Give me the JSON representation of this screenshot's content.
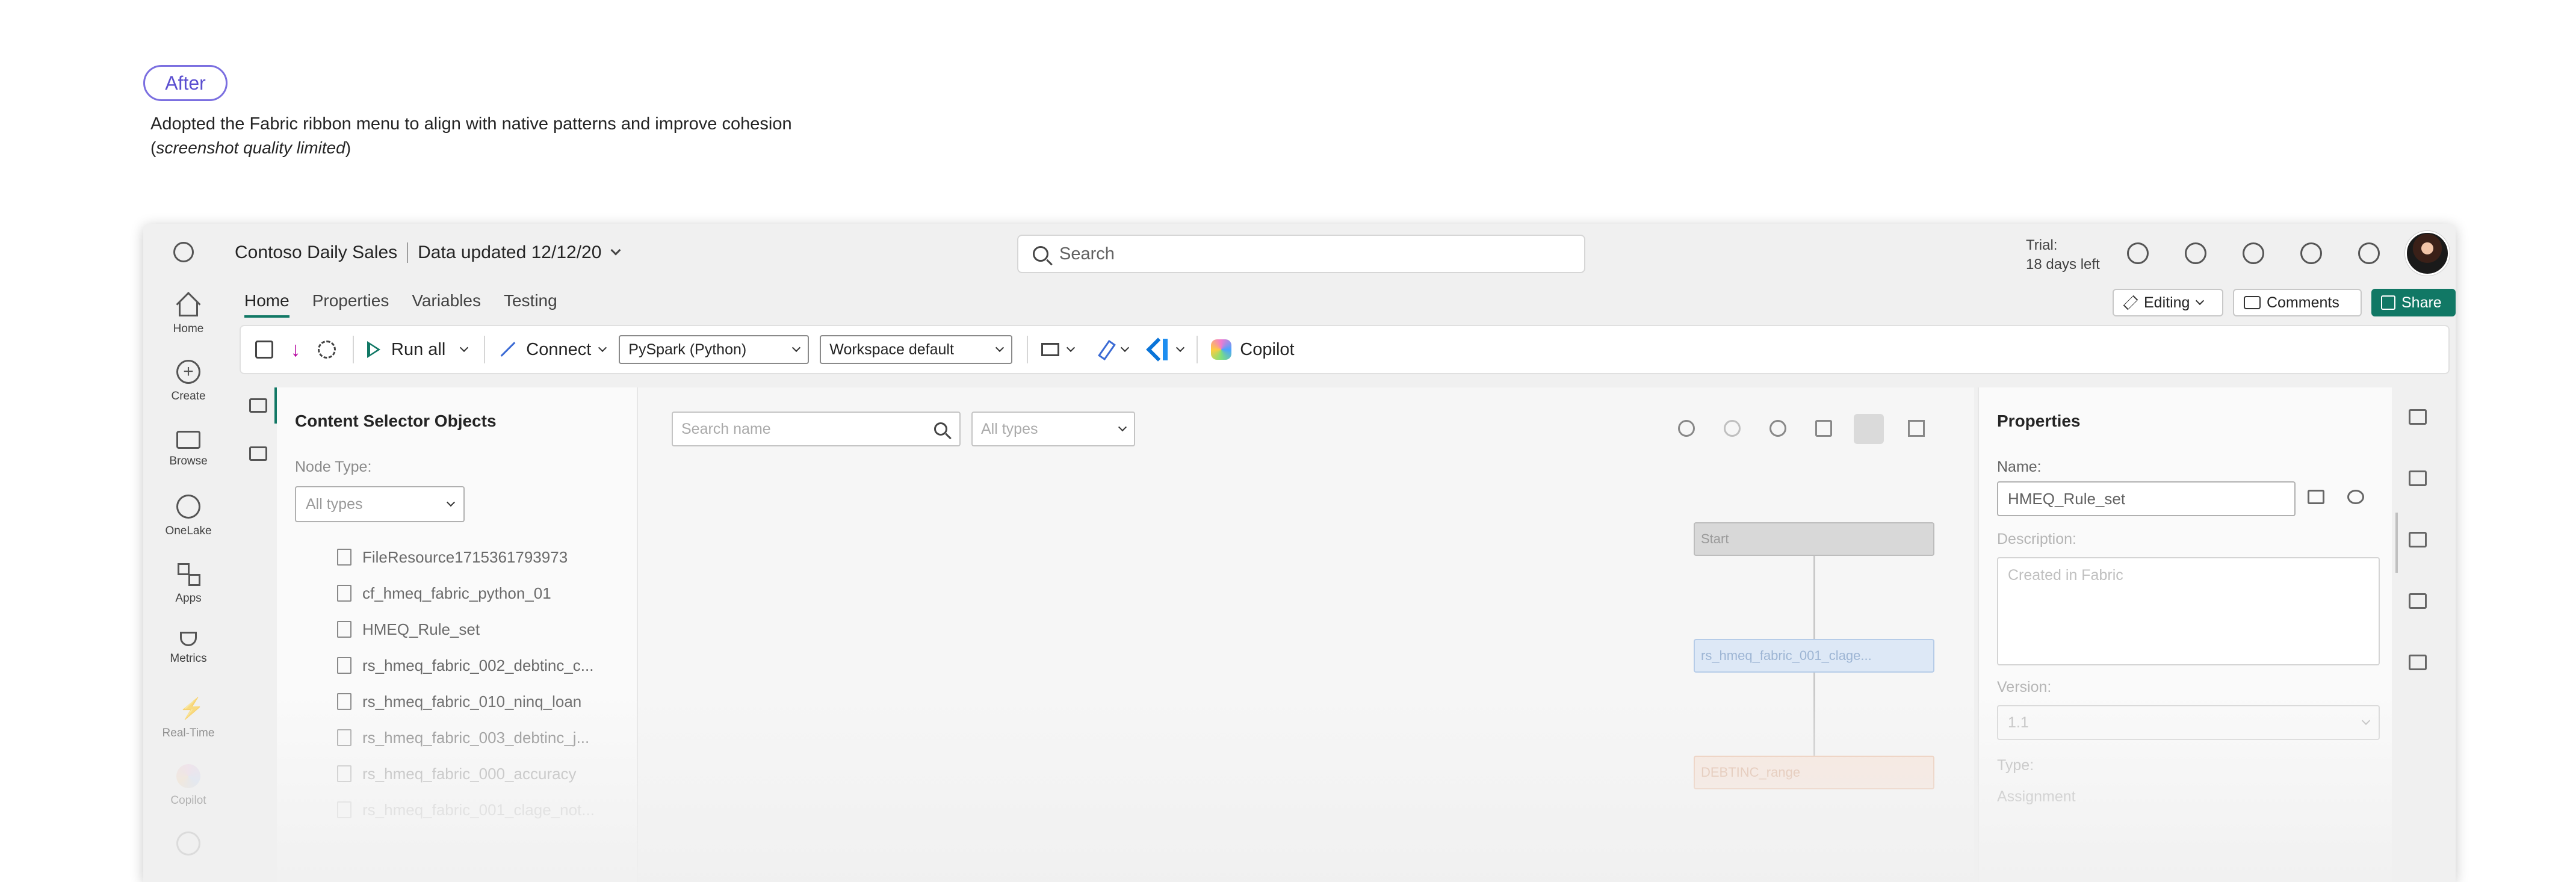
{
  "annotation": {
    "badge": "After",
    "caption": "Adopted the Fabric ribbon menu to align with native patterns and improve cohesion",
    "note_open": "(",
    "note_italic": "screenshot quality limited",
    "note_close": ")"
  },
  "header": {
    "item_name": "Contoso Daily Sales",
    "data_updated": "Data updated 12/12/20",
    "search_placeholder": "Search",
    "trial_line1": "Trial:",
    "trial_line2": "18 days left"
  },
  "left_nav": [
    {
      "label": "Home",
      "icon": "home-icon"
    },
    {
      "label": "Create",
      "icon": "create-icon"
    },
    {
      "label": "Browse",
      "icon": "browse-icon"
    },
    {
      "label": "OneLake",
      "icon": "onelake-icon"
    },
    {
      "label": "Apps",
      "icon": "apps-icon"
    },
    {
      "label": "Metrics",
      "icon": "metrics-icon"
    },
    {
      "label": "Real-Time",
      "icon": "realtime-icon"
    },
    {
      "label": "Copilot",
      "icon": "copilot-icon"
    }
  ],
  "tabs": [
    "Home",
    "Properties",
    "Variables",
    "Testing"
  ],
  "actions": {
    "editing": "Editing",
    "comments": "Comments",
    "share": "Share"
  },
  "ribbon": {
    "run_all": "Run all",
    "connect": "Connect",
    "language": "PySpark (Python)",
    "environment": "Workspace default",
    "copilot": "Copilot"
  },
  "selector_panel": {
    "title": "Content Selector Objects",
    "node_type_label": "Node Type:",
    "node_type_value": "All types",
    "items": [
      "FileResource1715361793973",
      "cf_hmeq_fabric_python_01",
      "HMEQ_Rule_set",
      "rs_hmeq_fabric_002_debtinc_c...",
      "rs_hmeq_fabric_010_ninq_loan",
      "rs_hmeq_fabric_003_debtinc_j...",
      "rs_hmeq_fabric_000_accuracy",
      "rs_hmeq_fabric_001_clage_not..."
    ]
  },
  "canvas": {
    "search_placeholder": "Search name",
    "types_value": "All types",
    "nodes": {
      "start": "Start",
      "ruleset": "rs_hmeq_fabric_001_clage...",
      "debtinc": "DEBTINC_range"
    }
  },
  "properties": {
    "title": "Properties",
    "name_label": "Name:",
    "name_value": "HMEQ_Rule_set",
    "description_label": "Description:",
    "description_value": "Created in Fabric",
    "version_label": "Version:",
    "version_value": "1.1",
    "type_label": "Type:",
    "type_value": "Assignment"
  }
}
